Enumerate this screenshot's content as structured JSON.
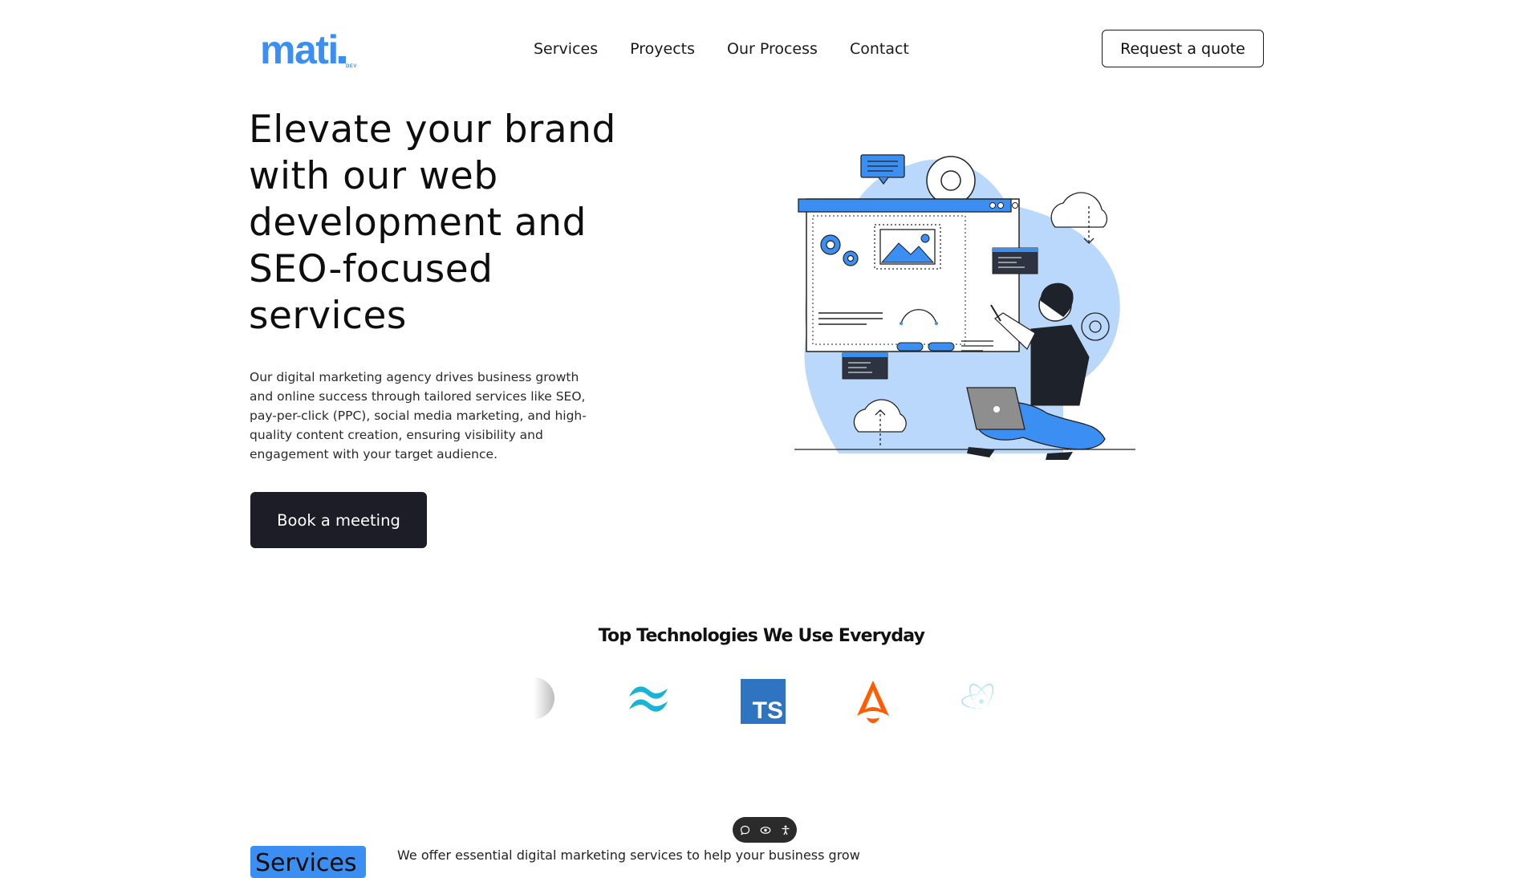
{
  "header": {
    "logo": {
      "text": "mati",
      "suffix": "DEV",
      "color": "#3b8ff3"
    },
    "nav": [
      "Services",
      "Proyects",
      "Our Process",
      "Contact"
    ],
    "cta_label": "Request a quote"
  },
  "hero": {
    "title": "Elevate your brand with our web development and SEO-focused services",
    "description": "Our digital marketing agency drives business growth and online success through tailored services like SEO, pay-per-click (PPC), social media marketing, and high-quality content creation, ensuring visibility and engagement with your target audience.",
    "button_label": "Book a meeting"
  },
  "technologies": {
    "title": "Top Technologies We Use Everyday",
    "logos": [
      "nextjs-icon",
      "tailwindcss-icon",
      "typescript-icon",
      "astro-icon",
      "react-icon"
    ],
    "ts_label": "TS"
  },
  "floating_toolbar": {
    "icons": [
      "chat-icon",
      "eye-icon",
      "accessibility-icon"
    ]
  },
  "services": {
    "badge": "Services",
    "intro": "We offer essential digital marketing services to help your business grow"
  },
  "colors": {
    "accent": "#3b8ff3",
    "dark_button": "#1c1d27",
    "illustration_blob": "#b9d8fb"
  }
}
